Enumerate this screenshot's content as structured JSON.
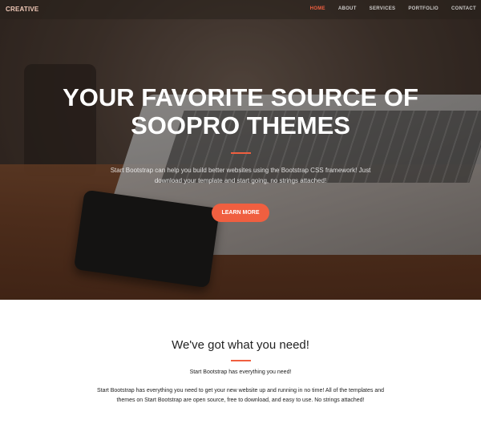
{
  "brand": "CREATIVE",
  "nav": {
    "items": [
      {
        "label": "HOME",
        "active": true
      },
      {
        "label": "ABOUT",
        "active": false
      },
      {
        "label": "SERVICES",
        "active": false
      },
      {
        "label": "PORTFOLIO",
        "active": false
      },
      {
        "label": "CONTACT",
        "active": false
      }
    ]
  },
  "hero": {
    "title_line1": "YOUR FAVORITE SOURCE OF",
    "title_line2": "SOOPRO THEMES",
    "text": "Start Bootstrap can help you build better websites using the Bootstrap CSS framework! Just download your template and start going, no strings attached!",
    "button": "LEARN MORE"
  },
  "section": {
    "heading": "We've got what you need!",
    "lead": "Start Bootstrap has everything you need!",
    "text": "Start Bootstrap has everything you need to get your new website up and running in no time! All of the templates and themes on Start Bootstrap are open source, free to download, and easy to use. No strings attached!"
  },
  "colors": {
    "accent": "#f05f40"
  }
}
